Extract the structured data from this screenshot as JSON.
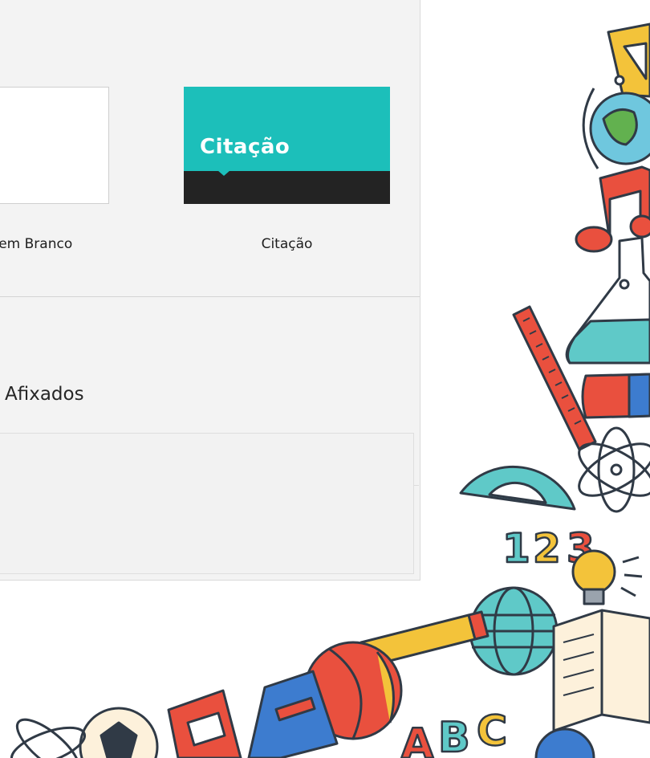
{
  "templates": [
    {
      "label": "ão em Branco"
    },
    {
      "label": "Citação",
      "preview_title": "Citação"
    }
  ],
  "pinned": {
    "title": "Afixados"
  },
  "colors": {
    "accent_teal": "#1cbfba",
    "preview_band": "#232323",
    "panel_bg": "#f3f3f3"
  }
}
